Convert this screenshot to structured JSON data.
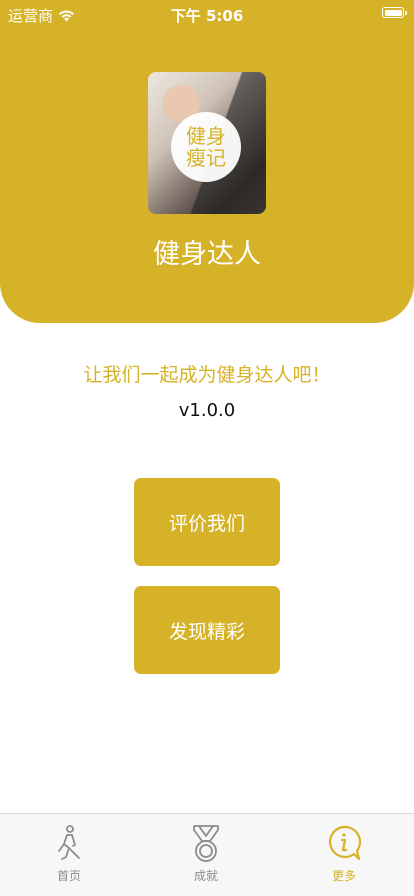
{
  "status_bar": {
    "carrier": "运营商",
    "time": "下午 5:06"
  },
  "header": {
    "logo_text": "健身瘦记",
    "app_name": "健身达人"
  },
  "main": {
    "slogan": "让我们一起成为健身达人吧！",
    "version": "v1.0.0",
    "rate_button": "评价我们",
    "discover_button": "发现精彩"
  },
  "tabbar": {
    "items": [
      {
        "label": "首页",
        "icon": "running-person-icon",
        "active": false
      },
      {
        "label": "成就",
        "icon": "medal-icon",
        "active": false
      },
      {
        "label": "更多",
        "icon": "info-bubble-icon",
        "active": true
      }
    ],
    "active_color": "#d6b228",
    "inactive_color": "#8c8c8c"
  },
  "colors": {
    "accent": "#d6b228",
    "background": "#ffffff"
  }
}
